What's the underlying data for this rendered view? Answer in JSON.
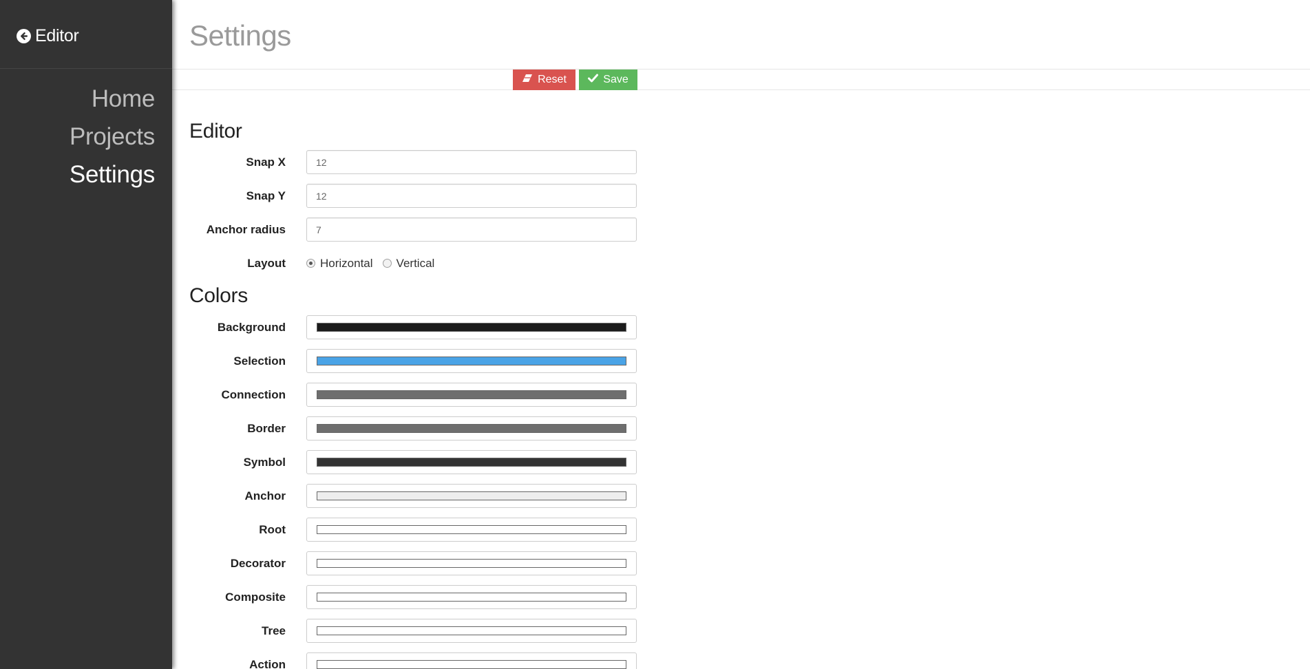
{
  "sidebar": {
    "back_label": "Editor",
    "nav": [
      {
        "label": "Home",
        "active": false
      },
      {
        "label": "Projects",
        "active": false
      },
      {
        "label": "Settings",
        "active": true
      }
    ]
  },
  "page": {
    "title": "Settings"
  },
  "toolbar": {
    "reset_label": "Reset",
    "save_label": "Save"
  },
  "editor": {
    "title": "Editor",
    "snap_x": {
      "label": "Snap X",
      "value": "12"
    },
    "snap_y": {
      "label": "Snap Y",
      "value": "12"
    },
    "anchor_radius": {
      "label": "Anchor radius",
      "value": "7"
    },
    "layout": {
      "label": "Layout",
      "options": [
        "Horizontal",
        "Vertical"
      ],
      "selected": "Horizontal"
    }
  },
  "colors": {
    "title": "Colors",
    "items": [
      {
        "label": "Background",
        "color": "#1b1b1b"
      },
      {
        "label": "Selection",
        "color": "#4aa3e6"
      },
      {
        "label": "Connection",
        "color": "#6e6e6e"
      },
      {
        "label": "Border",
        "color": "#6e6e6e"
      },
      {
        "label": "Symbol",
        "color": "#333333"
      },
      {
        "label": "Anchor",
        "color": "#eeeeee"
      },
      {
        "label": "Root",
        "color": "#ffffff"
      },
      {
        "label": "Decorator",
        "color": "#ffffff"
      },
      {
        "label": "Composite",
        "color": "#ffffff"
      },
      {
        "label": "Tree",
        "color": "#ffffff"
      },
      {
        "label": "Action",
        "color": "#ffffff"
      }
    ]
  }
}
